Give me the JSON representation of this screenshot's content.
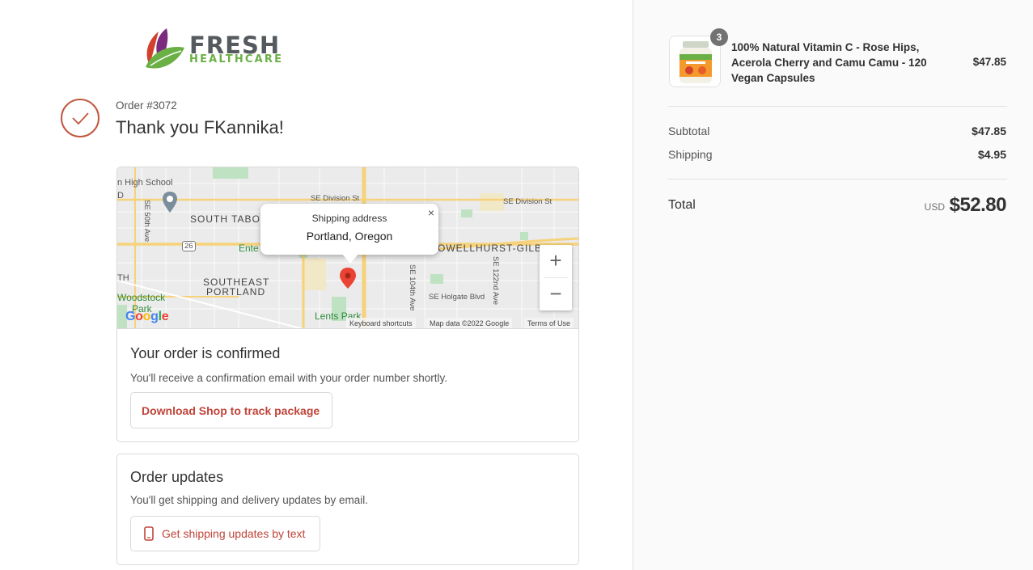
{
  "brand": {
    "name": "FRESH",
    "tagline": "HEALTHCARE",
    "colors": {
      "dark": "#555a5f",
      "green": "#6ab045",
      "purple": "#7a2b7d",
      "red": "#d3402c"
    }
  },
  "header": {
    "order_number": "Order #3072",
    "thank_you": "Thank you FKannika!"
  },
  "map": {
    "labels": {
      "high_school": "n High School",
      "d": "D",
      "south_tabor": "SOUTH TABOR",
      "se_division_1": "SE Division St",
      "se_division_2": "SE Division St",
      "se_50th": "SE 50th Ave",
      "route_26": "26",
      "ente": "Ente",
      "powellhurst": "OWELLHURST-GILB",
      "th": "TH",
      "southeast": "SOUTHEAST",
      "portland": "PORTLAND",
      "se_104th": "SE 104th Ave",
      "se_122nd": "SE 122nd Ave",
      "se_holgate": "SE Holgate Blvd",
      "woodstock": "Woodstock",
      "park": "Park",
      "lents_park": "Lents Park"
    },
    "popup": {
      "title": "Shipping address",
      "city": "Portland, Oregon",
      "close": "×"
    },
    "zoom_in": "+",
    "zoom_out": "−",
    "google": "Google",
    "keyboard_shortcuts": "Keyboard shortcuts",
    "map_data": "Map data ©2022 Google",
    "terms": "Terms of Use",
    "pin_color": "#ea4335"
  },
  "confirmed": {
    "title": "Your order is confirmed",
    "text": "You'll receive a confirmation email with your order number shortly.",
    "button": "Download Shop to track package"
  },
  "updates": {
    "title": "Order updates",
    "text": "You'll get shipping and delivery updates by email.",
    "button": "Get shipping updates by text",
    "button_icon": "phone-icon"
  },
  "summary": {
    "product": {
      "name": "100% Natural Vitamin C - Rose Hips, Acerola Cherry and Camu Camu - 120 Vegan Capsules",
      "price": "$47.85",
      "quantity": "3"
    },
    "subtotal_label": "Subtotal",
    "subtotal_value": "$47.85",
    "shipping_label": "Shipping",
    "shipping_value": "$4.95",
    "total_label": "Total",
    "currency": "USD",
    "total_value": "$52.80"
  },
  "accent_color": "#c0453a"
}
